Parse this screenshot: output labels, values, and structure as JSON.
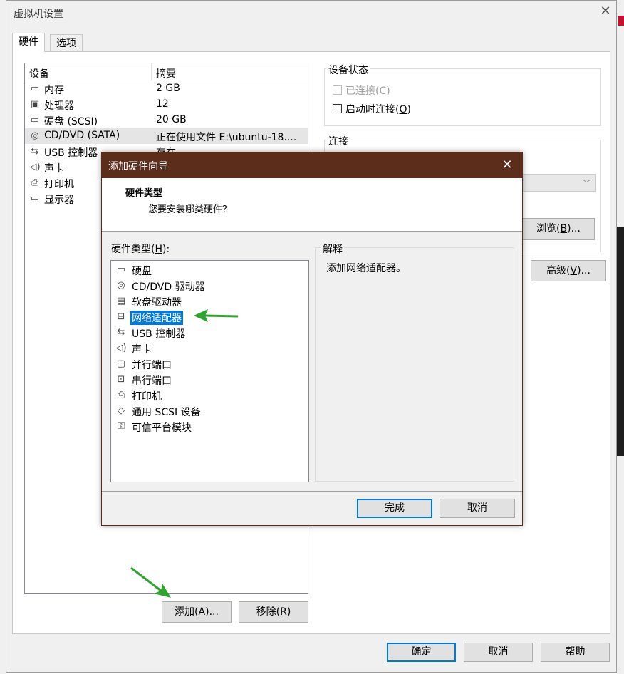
{
  "window": {
    "title": "虚拟机设置"
  },
  "tabs": [
    {
      "label": "硬件"
    },
    {
      "label": "选项"
    }
  ],
  "device_list": {
    "headers": {
      "device": "设备",
      "summary": "摘要"
    },
    "rows": [
      {
        "icon": "memory-icon",
        "name": "内存",
        "summary": "2 GB"
      },
      {
        "icon": "processor-icon",
        "name": "处理器",
        "summary": "12"
      },
      {
        "icon": "harddisk-icon",
        "name": "硬盘 (SCSI)",
        "summary": "20 GB"
      },
      {
        "icon": "cd-dvd-icon",
        "name": "CD/DVD (SATA)",
        "summary": "正在使用文件 E:\\ubuntu-18...."
      },
      {
        "icon": "usb-icon",
        "name": "USB 控制器",
        "summary": "存在"
      },
      {
        "icon": "sound-icon",
        "name": "声卡",
        "summary": ""
      },
      {
        "icon": "printer-icon",
        "name": "打印机",
        "summary": ""
      },
      {
        "icon": "display-icon",
        "name": "显示器",
        "summary": ""
      }
    ]
  },
  "buttons": {
    "add": "添加(A)...",
    "add_pre": "添加(",
    "add_key": "A",
    "add_post": ")...",
    "remove_pre": "移除(",
    "remove_key": "R",
    "remove_post": ")",
    "ok": "确定",
    "cancel": "取消",
    "help": "帮助"
  },
  "device_status": {
    "title": "设备状态",
    "connected_pre": "已连接(",
    "connected_key": "C",
    "connected_post": ")",
    "poweron_pre": "启动时连接(",
    "poweron_key": "O",
    "poweron_post": ")"
  },
  "connection": {
    "title": "连接",
    "browse_pre": "浏览(",
    "browse_key": "B",
    "browse_post": ")...",
    "advanced_pre": "高级(",
    "advanced_key": "V",
    "advanced_post": ")..."
  },
  "wizard": {
    "title": "添加硬件向导",
    "heading": "硬件类型",
    "subheading": "您要安装哪类硬件？",
    "list_label_pre": "硬件类型(",
    "list_label_key": "H",
    "list_label_post": "):",
    "items": [
      {
        "icon": "harddisk-icon",
        "label": "硬盘"
      },
      {
        "icon": "cd-dvd-icon",
        "label": "CD/DVD 驱动器"
      },
      {
        "icon": "floppy-icon",
        "label": "软盘驱动器"
      },
      {
        "icon": "network-adapter-icon",
        "label": "网络适配器",
        "selected": true
      },
      {
        "icon": "usb-icon",
        "label": "USB 控制器"
      },
      {
        "icon": "sound-icon",
        "label": "声卡"
      },
      {
        "icon": "parallel-port-icon",
        "label": "并行端口"
      },
      {
        "icon": "serial-port-icon",
        "label": "串行端口"
      },
      {
        "icon": "printer-icon",
        "label": "打印机"
      },
      {
        "icon": "scsi-device-icon",
        "label": "通用 SCSI 设备"
      },
      {
        "icon": "tpm-icon",
        "label": "可信平台模块"
      }
    ],
    "explain_title": "解释",
    "explain_text": "添加网络适配器。",
    "finish": "完成",
    "cancel": "取消"
  },
  "colors": {
    "wizard_titlebar": "#5c2d1a",
    "selection": "#0078d7",
    "arrow": "#2ca52c"
  }
}
